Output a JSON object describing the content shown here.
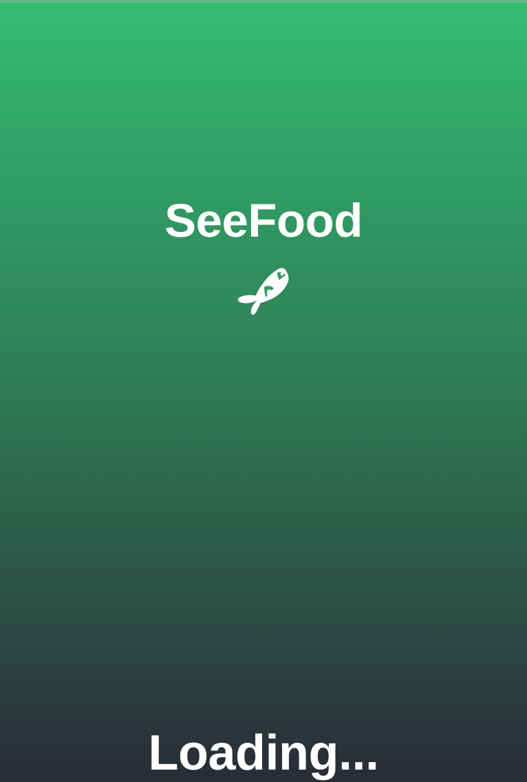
{
  "splash": {
    "title": "SeeFood",
    "loading_text": "Loading...",
    "icon": "fish-icon"
  },
  "colors": {
    "gradient_top": "#33bc71",
    "gradient_middle": "#2e7a56",
    "gradient_bottom": "#2a2b36",
    "text": "#ffffff"
  }
}
